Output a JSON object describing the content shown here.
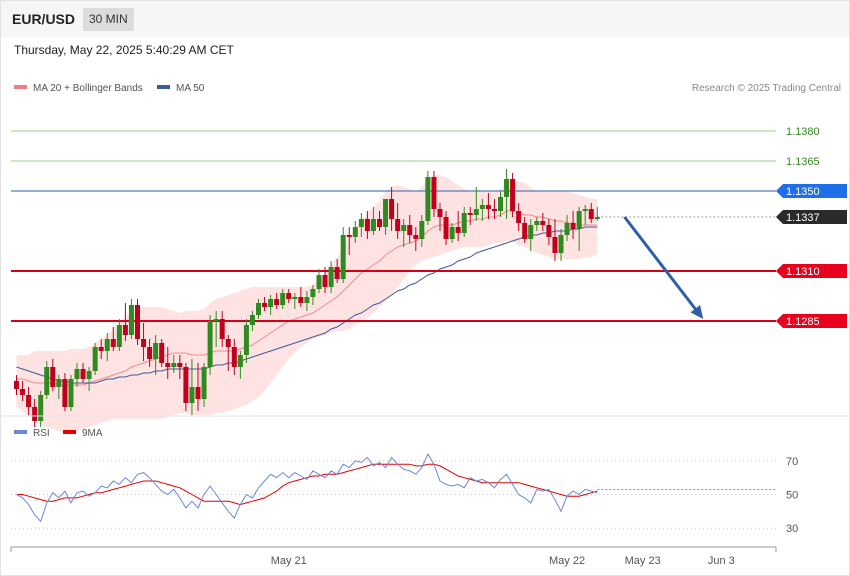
{
  "header": {
    "symbol": "EUR/USD",
    "interval": "30 MIN",
    "datetime": "Thursday, May 22, 2025 5:40:29 AM CET"
  },
  "legend": {
    "ma20": "MA 20 + Bollinger Bands",
    "ma50": "MA 50",
    "credit": "Research © 2025 Trading Central",
    "rsi": "RSI",
    "ma9": "9MA"
  },
  "colors": {
    "bull": "#2f8a1f",
    "bear": "#c0001c",
    "band_fill": "#ffd9d9",
    "ma20": "#f08080",
    "ma50": "#3b5b9f",
    "rsi": "#6a88d8",
    "ma9": "#e00000",
    "arrow": "#2f5fa8"
  },
  "chart_data": [
    {
      "type": "candlestick",
      "ylim": [
        1.1235,
        1.1395
      ],
      "price_levels": [
        {
          "value": 1.138,
          "label": "1.1380",
          "style": "target"
        },
        {
          "value": 1.1365,
          "label": "1.1365",
          "style": "target"
        },
        {
          "value": 1.135,
          "label": "1.1350",
          "style": "pivot"
        },
        {
          "value": 1.1337,
          "label": "1.1337",
          "style": "last"
        },
        {
          "value": 1.131,
          "label": "1.1310",
          "style": "support"
        },
        {
          "value": 1.1285,
          "label": "1.1285",
          "style": "support"
        }
      ],
      "x_ticks": [
        {
          "index": 45,
          "label": "May 21"
        },
        {
          "index": 91,
          "label": "May 22"
        },
        {
          "index": 103.5,
          "label": "May 23"
        },
        {
          "index": 116.5,
          "label": "Jun 3"
        }
      ],
      "candles": [
        [
          1.1255,
          1.1258,
          1.1248,
          1.1251
        ],
        [
          1.1251,
          1.1255,
          1.1245,
          1.1248
        ],
        [
          1.1248,
          1.1252,
          1.1238,
          1.1242
        ],
        [
          1.1242,
          1.1246,
          1.1232,
          1.1235
        ],
        [
          1.1235,
          1.125,
          1.1232,
          1.1248
        ],
        [
          1.1248,
          1.1265,
          1.1246,
          1.1262
        ],
        [
          1.1262,
          1.1266,
          1.125,
          1.1252
        ],
        [
          1.1252,
          1.1258,
          1.1246,
          1.1256
        ],
        [
          1.1256,
          1.1259,
          1.124,
          1.1242
        ],
        [
          1.1242,
          1.1258,
          1.124,
          1.1256
        ],
        [
          1.1256,
          1.1264,
          1.1252,
          1.1261
        ],
        [
          1.1261,
          1.1264,
          1.1254,
          1.1256
        ],
        [
          1.1256,
          1.1262,
          1.125,
          1.126
        ],
        [
          1.126,
          1.1274,
          1.1258,
          1.1272
        ],
        [
          1.1272,
          1.1276,
          1.1266,
          1.127
        ],
        [
          1.127,
          1.1279,
          1.1265,
          1.1276
        ],
        [
          1.1276,
          1.1282,
          1.127,
          1.1272
        ],
        [
          1.1272,
          1.1286,
          1.127,
          1.1283
        ],
        [
          1.1283,
          1.1294,
          1.1275,
          1.1278
        ],
        [
          1.1278,
          1.1296,
          1.1276,
          1.1293
        ],
        [
          1.1293,
          1.1296,
          1.1273,
          1.1276
        ],
        [
          1.1276,
          1.1284,
          1.1265,
          1.1272
        ],
        [
          1.1272,
          1.1276,
          1.1262,
          1.1266
        ],
        [
          1.1266,
          1.1278,
          1.1258,
          1.1274
        ],
        [
          1.1274,
          1.1276,
          1.1262,
          1.1264
        ],
        [
          1.1264,
          1.1272,
          1.1256,
          1.1262
        ],
        [
          1.1262,
          1.1268,
          1.1259,
          1.1264
        ],
        [
          1.1264,
          1.1268,
          1.1256,
          1.1262
        ],
        [
          1.1262,
          1.1264,
          1.124,
          1.1244
        ],
        [
          1.1244,
          1.1266,
          1.1238,
          1.1252
        ],
        [
          1.1252,
          1.1264,
          1.124,
          1.1246
        ],
        [
          1.1246,
          1.1264,
          1.1242,
          1.1262
        ],
        [
          1.1262,
          1.1288,
          1.1258,
          1.1285
        ],
        [
          1.1285,
          1.129,
          1.1272,
          1.1286
        ],
        [
          1.1286,
          1.129,
          1.1272,
          1.1276
        ],
        [
          1.1276,
          1.1278,
          1.126,
          1.1272
        ],
        [
          1.1272,
          1.1276,
          1.1258,
          1.1262
        ],
        [
          1.1262,
          1.127,
          1.1256,
          1.1268
        ],
        [
          1.1268,
          1.1286,
          1.1264,
          1.1283
        ],
        [
          1.1283,
          1.129,
          1.128,
          1.1288
        ],
        [
          1.1288,
          1.1296,
          1.1286,
          1.1294
        ],
        [
          1.1294,
          1.1297,
          1.129,
          1.1292
        ],
        [
          1.1292,
          1.1298,
          1.1288,
          1.1296
        ],
        [
          1.1296,
          1.1299,
          1.1291,
          1.1293
        ],
        [
          1.1293,
          1.1301,
          1.1291,
          1.1299
        ],
        [
          1.1299,
          1.1301,
          1.1294,
          1.1296
        ],
        [
          1.1296,
          1.1299,
          1.1291,
          1.1297
        ],
        [
          1.1297,
          1.1302,
          1.1292,
          1.1294
        ],
        [
          1.1294,
          1.13,
          1.129,
          1.1297
        ],
        [
          1.1297,
          1.1303,
          1.1293,
          1.1301
        ],
        [
          1.1301,
          1.1311,
          1.1299,
          1.1308
        ],
        [
          1.1308,
          1.1312,
          1.1299,
          1.1302
        ],
        [
          1.1302,
          1.1315,
          1.1299,
          1.1312
        ],
        [
          1.1312,
          1.1316,
          1.1304,
          1.1306
        ],
        [
          1.1306,
          1.1332,
          1.1304,
          1.1328
        ],
        [
          1.1328,
          1.1332,
          1.1318,
          1.1327
        ],
        [
          1.1327,
          1.1335,
          1.1324,
          1.1332
        ],
        [
          1.1332,
          1.1339,
          1.1327,
          1.1336
        ],
        [
          1.1336,
          1.134,
          1.1326,
          1.133
        ],
        [
          1.133,
          1.1342,
          1.1328,
          1.1336
        ],
        [
          1.1336,
          1.134,
          1.133,
          1.1332
        ],
        [
          1.1332,
          1.1345,
          1.1328,
          1.1346
        ],
        [
          1.1346,
          1.1352,
          1.133,
          1.1336
        ],
        [
          1.1336,
          1.1344,
          1.1326,
          1.133
        ],
        [
          1.133,
          1.1336,
          1.1322,
          1.1333
        ],
        [
          1.1333,
          1.1338,
          1.1324,
          1.1328
        ],
        [
          1.1328,
          1.1332,
          1.132,
          1.1326
        ],
        [
          1.1326,
          1.1338,
          1.1322,
          1.1335
        ],
        [
          1.1335,
          1.136,
          1.1333,
          1.1357
        ],
        [
          1.1357,
          1.136,
          1.1337,
          1.1341
        ],
        [
          1.1341,
          1.1344,
          1.133,
          1.1337
        ],
        [
          1.1337,
          1.134,
          1.1323,
          1.1326
        ],
        [
          1.1326,
          1.1334,
          1.1324,
          1.1332
        ],
        [
          1.1332,
          1.134,
          1.1325,
          1.1329
        ],
        [
          1.1329,
          1.1342,
          1.1327,
          1.1339
        ],
        [
          1.1339,
          1.1342,
          1.1333,
          1.1338
        ],
        [
          1.1338,
          1.1352,
          1.1335,
          1.1341
        ],
        [
          1.1341,
          1.1346,
          1.1335,
          1.1343
        ],
        [
          1.1343,
          1.1349,
          1.1336,
          1.1341
        ],
        [
          1.1341,
          1.1346,
          1.1336,
          1.134
        ],
        [
          1.134,
          1.135,
          1.1337,
          1.1347
        ],
        [
          1.1347,
          1.1361,
          1.1336,
          1.1356
        ],
        [
          1.1356,
          1.1359,
          1.1337,
          1.134
        ],
        [
          1.134,
          1.1344,
          1.133,
          1.1334
        ],
        [
          1.1334,
          1.1337,
          1.1324,
          1.1326
        ],
        [
          1.1326,
          1.1336,
          1.132,
          1.1333
        ],
        [
          1.1333,
          1.1337,
          1.133,
          1.1335
        ],
        [
          1.1335,
          1.1339,
          1.133,
          1.1333
        ],
        [
          1.1333,
          1.1336,
          1.1323,
          1.1327
        ],
        [
          1.1327,
          1.1336,
          1.1315,
          1.1319
        ],
        [
          1.1319,
          1.1331,
          1.1315,
          1.1328
        ],
        [
          1.1328,
          1.1338,
          1.1325,
          1.1334
        ],
        [
          1.1334,
          1.134,
          1.1326,
          1.1331
        ],
        [
          1.1331,
          1.1342,
          1.132,
          1.134
        ],
        [
          1.134,
          1.1343,
          1.1333,
          1.1341
        ],
        [
          1.1341,
          1.1344,
          1.1334,
          1.1336
        ],
        [
          1.1336,
          1.1342,
          1.1335,
          1.1337
        ]
      ],
      "ma20": [
        1.1256,
        1.1256,
        1.1255,
        1.1254,
        1.1254,
        1.1254,
        1.1254,
        1.1253,
        1.1253,
        1.1253,
        1.1253,
        1.1253,
        1.1254,
        1.1255,
        1.1256,
        1.1257,
        1.1258,
        1.1259,
        1.126,
        1.1262,
        1.1263,
        1.1264,
        1.1265,
        1.1266,
        1.1267,
        1.1268,
        1.1269,
        1.1269,
        1.1269,
        1.1268,
        1.1268,
        1.1268,
        1.1269,
        1.127,
        1.127,
        1.127,
        1.127,
        1.1271,
        1.1272,
        1.1273,
        1.1275,
        1.1277,
        1.1279,
        1.1281,
        1.1283,
        1.1285,
        1.1286,
        1.1287,
        1.1288,
        1.1289,
        1.1291,
        1.1293,
        1.1295,
        1.1297,
        1.13,
        1.1303,
        1.1306,
        1.1309,
        1.1311,
        1.1313,
        1.1315,
        1.1318,
        1.132,
        1.1322,
        1.1323,
        1.1324,
        1.1325,
        1.1327,
        1.133,
        1.1332,
        1.1333,
        1.1333,
        1.1333,
        1.1334,
        1.1335,
        1.1335,
        1.1336,
        1.1336,
        1.1337,
        1.1337,
        1.1338,
        1.134,
        1.134,
        1.1339,
        1.1338,
        1.1338,
        1.1337,
        1.1337,
        1.1336,
        1.1335,
        1.1335,
        1.1334,
        1.1334,
        1.1333,
        1.1333,
        1.1333,
        1.1333
      ],
      "bb_upper": [
        1.1268,
        1.1268,
        1.1268,
        1.127,
        1.127,
        1.127,
        1.127,
        1.127,
        1.127,
        1.1271,
        1.1271,
        1.1271,
        1.1272,
        1.1274,
        1.1276,
        1.1278,
        1.1281,
        1.1284,
        1.1287,
        1.129,
        1.1292,
        1.1292,
        1.1292,
        1.1292,
        1.1292,
        1.1291,
        1.129,
        1.1289,
        1.129,
        1.129,
        1.129,
        1.1291,
        1.1294,
        1.1296,
        1.1297,
        1.1298,
        1.1299,
        1.13,
        1.1301,
        1.1302,
        1.1302,
        1.1302,
        1.1302,
        1.1302,
        1.1302,
        1.1302,
        1.1302,
        1.1302,
        1.1302,
        1.1303,
        1.1306,
        1.1309,
        1.1313,
        1.1317,
        1.1322,
        1.1327,
        1.1331,
        1.1335,
        1.1339,
        1.1342,
        1.1345,
        1.135,
        1.1352,
        1.1353,
        1.1352,
        1.1351,
        1.135,
        1.1352,
        1.1356,
        1.1358,
        1.1358,
        1.1357,
        1.1355,
        1.1353,
        1.1351,
        1.135,
        1.135,
        1.135,
        1.135,
        1.135,
        1.1351,
        1.1354,
        1.1355,
        1.1355,
        1.1354,
        1.1352,
        1.135,
        1.135,
        1.135,
        1.135,
        1.135,
        1.135,
        1.1349,
        1.1348,
        1.1347,
        1.1346,
        1.1346
      ],
      "bb_lower": [
        1.1242,
        1.124,
        1.1238,
        1.1235,
        1.1233,
        1.1232,
        1.1231,
        1.123,
        1.1229,
        1.123,
        1.123,
        1.1231,
        1.1232,
        1.1233,
        1.1234,
        1.1235,
        1.1236,
        1.1236,
        1.1236,
        1.1236,
        1.1236,
        1.1236,
        1.1236,
        1.1236,
        1.1236,
        1.1237,
        1.1238,
        1.1239,
        1.1239,
        1.1238,
        1.1238,
        1.1238,
        1.1238,
        1.1239,
        1.1239,
        1.124,
        1.1241,
        1.1242,
        1.1243,
        1.1245,
        1.1247,
        1.125,
        1.1254,
        1.1258,
        1.1262,
        1.1266,
        1.1269,
        1.1272,
        1.1274,
        1.1276,
        1.1277,
        1.1278,
        1.1279,
        1.128,
        1.128,
        1.1281,
        1.1283,
        1.1285,
        1.1287,
        1.1289,
        1.1292,
        1.1295,
        1.1298,
        1.1302,
        1.1306,
        1.131,
        1.1313,
        1.1315,
        1.1316,
        1.1317,
        1.1318,
        1.1319,
        1.132,
        1.1321,
        1.1322,
        1.1322,
        1.1322,
        1.1322,
        1.1323,
        1.1324,
        1.1324,
        1.1325,
        1.1325,
        1.1323,
        1.1322,
        1.132,
        1.1319,
        1.1318,
        1.1317,
        1.1316,
        1.1316,
        1.1316,
        1.1316,
        1.1316,
        1.1317,
        1.1317,
        1.1318
      ],
      "ma50": [
        1.1262,
        1.1261,
        1.126,
        1.1259,
        1.1258,
        1.1257,
        1.1256,
        1.1255,
        1.1255,
        1.1254,
        1.1254,
        1.1254,
        1.1254,
        1.1254,
        1.1255,
        1.1256,
        1.1256,
        1.1257,
        1.1257,
        1.1258,
        1.1258,
        1.1259,
        1.1259,
        1.126,
        1.126,
        1.1261,
        1.1261,
        1.1261,
        1.1261,
        1.1261,
        1.1261,
        1.1261,
        1.1262,
        1.1263,
        1.1263,
        1.1264,
        1.1264,
        1.1265,
        1.1266,
        1.1267,
        1.1268,
        1.1269,
        1.127,
        1.1271,
        1.1272,
        1.1273,
        1.1274,
        1.1275,
        1.1276,
        1.1277,
        1.1278,
        1.1279,
        1.1281,
        1.1282,
        1.1284,
        1.1286,
        1.1288,
        1.1289,
        1.1291,
        1.1293,
        1.1294,
        1.1296,
        1.1298,
        1.13,
        1.1301,
        1.1303,
        1.1304,
        1.1306,
        1.1308,
        1.1309,
        1.1311,
        1.1312,
        1.1313,
        1.1315,
        1.1316,
        1.1317,
        1.1319,
        1.132,
        1.1321,
        1.1322,
        1.1323,
        1.1324,
        1.1325,
        1.1326,
        1.1327,
        1.1328,
        1.1328,
        1.1329,
        1.1329,
        1.133,
        1.133,
        1.133,
        1.1331,
        1.1331,
        1.1332,
        1.1332,
        1.1332
      ],
      "projection": {
        "from_index": 100.5,
        "from_value": 1.1337,
        "to_index": 114.5,
        "to_value": 1.1285
      }
    },
    {
      "type": "line",
      "ylim": [
        20,
        80
      ],
      "y_ticks": [
        30,
        50,
        70
      ],
      "current_value": 53,
      "rsi": [
        50,
        48,
        44,
        38,
        34,
        45,
        51,
        48,
        52,
        45,
        51,
        52,
        49,
        51,
        55,
        54,
        58,
        56,
        60,
        57,
        62,
        63,
        60,
        56,
        52,
        50,
        53,
        48,
        42,
        46,
        42,
        50,
        55,
        50,
        45,
        40,
        36,
        44,
        50,
        48,
        54,
        58,
        62,
        60,
        63,
        60,
        63,
        61,
        59,
        64,
        62,
        60,
        64,
        62,
        68,
        66,
        70,
        69,
        72,
        67,
        69,
        66,
        72,
        68,
        65,
        64,
        62,
        66,
        74,
        68,
        58,
        56,
        55,
        56,
        54,
        60,
        58,
        59,
        57,
        54,
        59,
        62,
        56,
        50,
        48,
        45,
        53,
        52,
        53,
        47,
        40,
        49,
        52,
        50,
        53,
        52,
        51
      ],
      "ma9": [
        50,
        50,
        49,
        48,
        47,
        46,
        46,
        47,
        48,
        48,
        48,
        49,
        50,
        51,
        51,
        52,
        53,
        54,
        55,
        56,
        57,
        58,
        58,
        58,
        57,
        56,
        55,
        54,
        52,
        50,
        48,
        46,
        46,
        46,
        46,
        46,
        45,
        44,
        45,
        46,
        47,
        48,
        50,
        52,
        55,
        57,
        58,
        59,
        60,
        61,
        61,
        62,
        62,
        62,
        63,
        64,
        65,
        66,
        67,
        68,
        68,
        68,
        68,
        68,
        68,
        68,
        67,
        67,
        68,
        68,
        67,
        65,
        63,
        61,
        60,
        59,
        58,
        57,
        57,
        57,
        57,
        57,
        57,
        57,
        56,
        55,
        54,
        53,
        52,
        51,
        50,
        49,
        49,
        49,
        50,
        51,
        52
      ]
    }
  ]
}
